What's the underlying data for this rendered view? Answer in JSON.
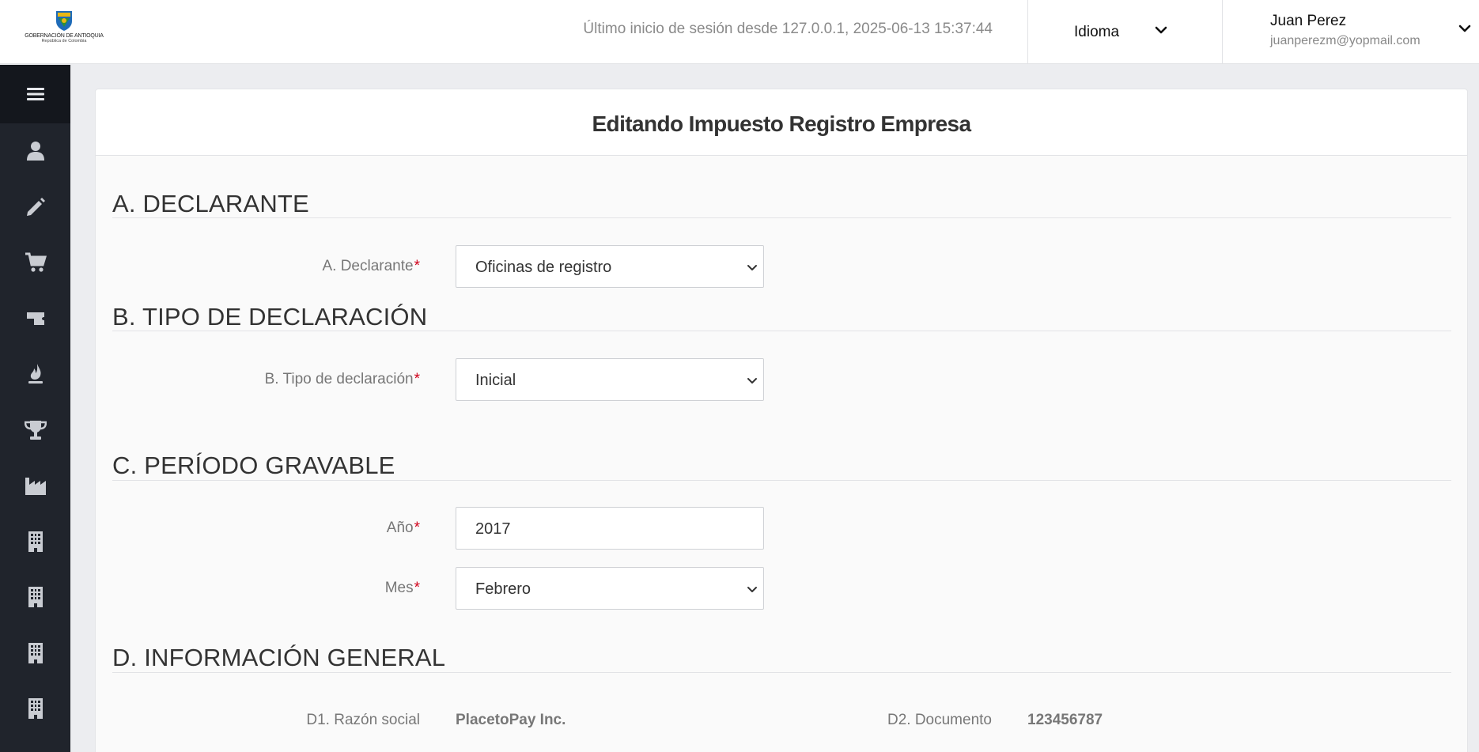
{
  "header": {
    "logo": {
      "line1": "GOBERNACIÓN DE ANTIOQUIA",
      "line2": "República de Colombia",
      "colors": {
        "shield": "#1e6bb8",
        "gold": "#e9b815",
        "green": "#2f8f3a"
      }
    },
    "last_login": "Último inicio de sesión desde 127.0.0.1, 2025-06-13 15:37:44",
    "language": {
      "label": "Idioma"
    },
    "user": {
      "name": "Juan Perez",
      "email": "juanperezm@yopmail.com"
    }
  },
  "sidebar": {
    "toggle_icon": "hamburger-icon",
    "items": [
      {
        "icon": "user-icon"
      },
      {
        "icon": "pencil-icon"
      },
      {
        "icon": "cart-icon"
      },
      {
        "icon": "ticket-icon"
      },
      {
        "icon": "flame-icon"
      },
      {
        "icon": "trophy-icon"
      },
      {
        "icon": "factory-icon"
      },
      {
        "icon": "building-icon"
      },
      {
        "icon": "building-icon"
      },
      {
        "icon": "building-icon"
      },
      {
        "icon": "building-icon"
      }
    ],
    "colors": {
      "background": "#20242c",
      "toggle_background": "#14171d",
      "icon": "#c9ccd2"
    }
  },
  "form": {
    "title": "Editando Impuesto Registro Empresa",
    "required_mark": "*",
    "sections": {
      "a": {
        "title": "A. DECLARANTE",
        "declarante": {
          "label": "A. Declarante",
          "value": "Oficinas de registro"
        }
      },
      "b": {
        "title": "B. TIPO DE DECLARACIÓN",
        "tipo": {
          "label": "B. Tipo de declaración",
          "value": "Inicial"
        }
      },
      "c": {
        "title": "C. PERÍODO GRAVABLE",
        "anio": {
          "label": "Año",
          "value": "2017"
        },
        "mes": {
          "label": "Mes",
          "value": "Febrero"
        }
      },
      "d": {
        "title": "D. INFORMACIÓN GENERAL",
        "razon_social": {
          "label": "D1. Razón social",
          "value": "PlacetoPay Inc."
        },
        "documento": {
          "label": "D2. Documento",
          "value": "123456787"
        }
      }
    }
  }
}
